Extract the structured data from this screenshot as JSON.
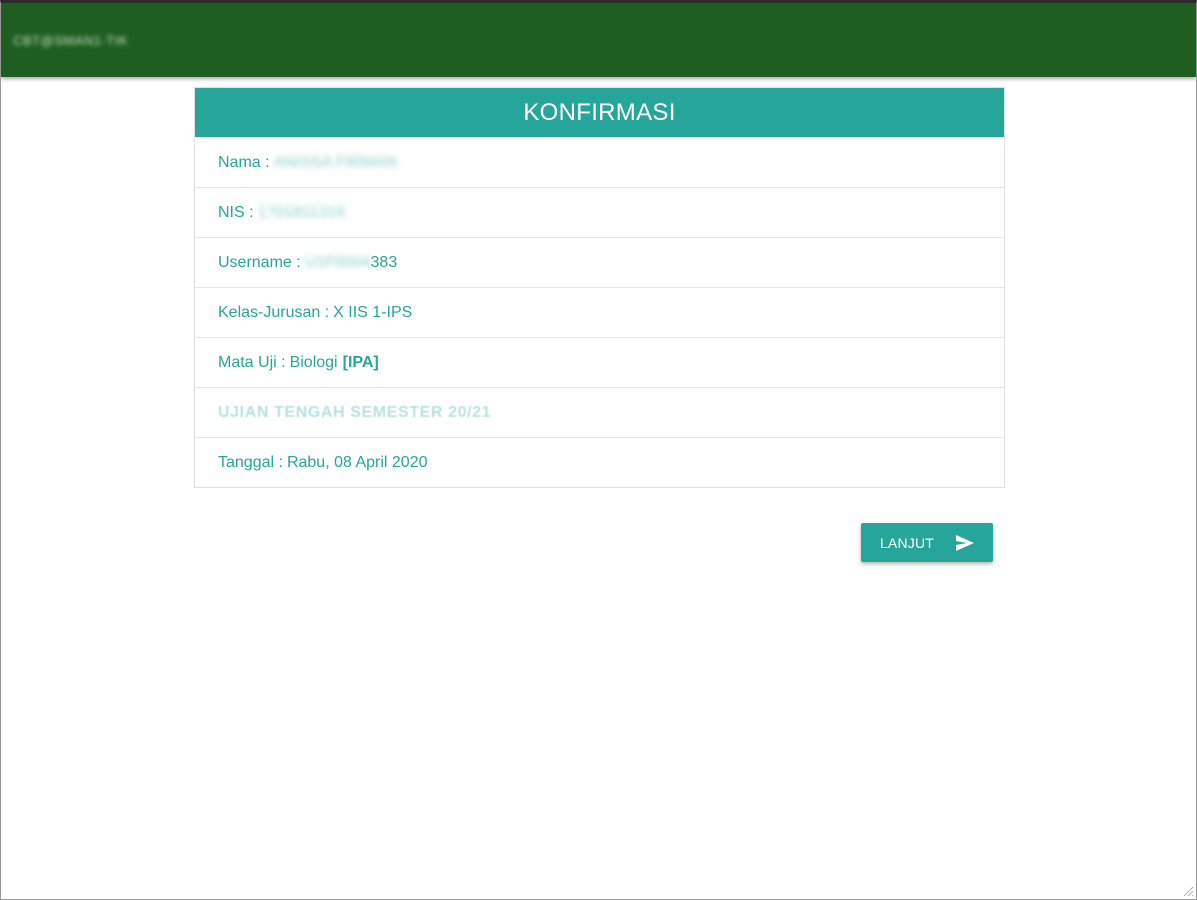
{
  "header": {
    "brand": "CBT@SMAN1-TIK"
  },
  "card": {
    "title": "KONFIRMASI",
    "rows": {
      "nama": {
        "label": "Nama :",
        "value": "ANISSA FIRMAN"
      },
      "nis": {
        "label": "NIS :",
        "value": "1701811316"
      },
      "username": {
        "label": "Username :",
        "value_hidden": "U1F0004",
        "value_visible": "383"
      },
      "kelas": {
        "label": "Kelas-Jurusan :",
        "value": "X IIS 1-IPS"
      },
      "mata_uji": {
        "label": "Mata Uji :",
        "value": "Biologi",
        "tag": "[IPA]"
      },
      "ujian": {
        "text": "UJIAN TENGAH SEMESTER 20/21"
      },
      "tanggal": {
        "label": "Tanggal :",
        "value": "Rabu, 08 April 2020"
      }
    }
  },
  "actions": {
    "next_label": "LANJUT"
  },
  "colors": {
    "header_bg": "#1e5e20",
    "accent": "#26a69a",
    "faded_text": "#b8e2de"
  },
  "icons": {
    "next": "send-arrow-icon"
  }
}
